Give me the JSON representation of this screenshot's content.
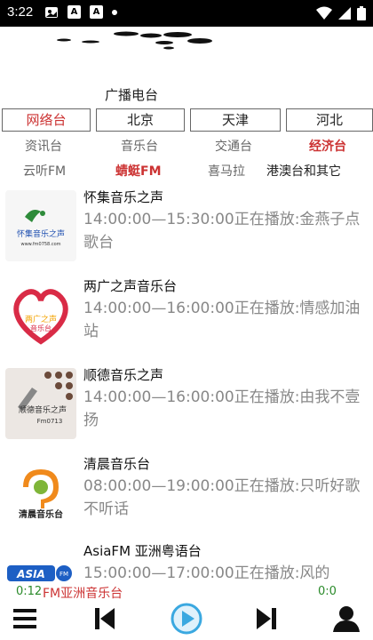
{
  "status_bar": {
    "time": "3:22",
    "icons": [
      "image-icon",
      "a-box-icon",
      "a-box-icon",
      "dot-icon",
      "wifi-icon",
      "signal-icon",
      "battery-icon"
    ]
  },
  "header": {
    "title": "广播电台"
  },
  "region_tabs": [
    {
      "label": "网络台",
      "active": true
    },
    {
      "label": "北京",
      "active": false
    },
    {
      "label": "天津",
      "active": false
    },
    {
      "label": "河北",
      "active": false
    }
  ],
  "categories": {
    "row1": [
      {
        "label": "资讯台",
        "active": false
      },
      {
        "label": "音乐台",
        "active": false
      },
      {
        "label": "交通台",
        "active": false
      },
      {
        "label": "经济台",
        "active": true
      }
    ],
    "row2": [
      {
        "label": "云听FM",
        "active": false
      },
      {
        "label": "蜻蜓FM",
        "active": true
      },
      {
        "label": "喜马拉",
        "active": false
      },
      {
        "label": "港澳台和其它",
        "active": false
      }
    ]
  },
  "stations": [
    {
      "name": "怀集音乐之声",
      "desc": "14:00:00—15:30:00正在播放:金燕子点歌台",
      "icon": "huaiji-logo-icon"
    },
    {
      "name": "两广之声音乐台",
      "desc": "14:00:00—16:00:00正在播放:情感加油站",
      "icon": "lianguang-heart-logo-icon"
    },
    {
      "name": "顺德音乐之声",
      "desc": "14:00:00—16:00:00正在播放:由我不壹扬",
      "icon": "shunde-logo-icon"
    },
    {
      "name": "清晨音乐台",
      "desc": "08:00:00—19:00:00正在播放:只听好歌不听话",
      "icon": "qingchen-logo-icon"
    },
    {
      "name": "AsiaFM 亚洲粤语台",
      "desc": "15:00:00—17:00:00正在播放:风的",
      "icon": "asiafm-logo-icon"
    }
  ],
  "player": {
    "position": "0:12",
    "duration": "0:0",
    "now_playing": "AsiaFM亚洲音乐台",
    "now_playing_visible": "FM亚洲音乐台"
  },
  "colors": {
    "accent_red": "#cc3333",
    "time_green": "#2a8a2a",
    "play_blue": "#3aa8e0"
  }
}
